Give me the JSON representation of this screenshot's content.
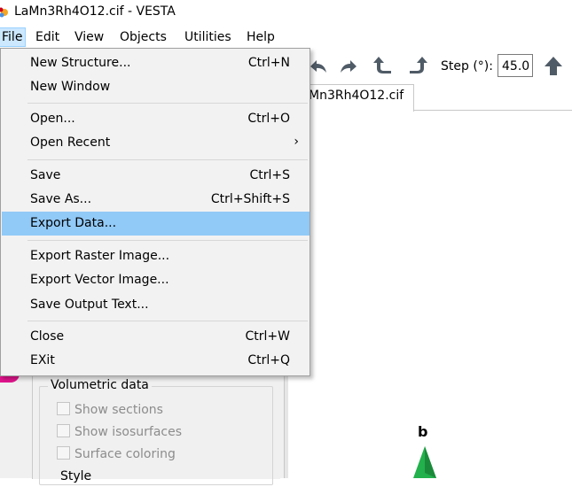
{
  "window": {
    "title": "LaMn3Rh4O12.cif - VESTA"
  },
  "menubar": {
    "items": [
      "File",
      "Edit",
      "View",
      "Objects",
      "Utilities",
      "Help"
    ]
  },
  "file_menu": {
    "items": [
      {
        "label": "New Structure...",
        "shortcut": "Ctrl+N"
      },
      {
        "label": "New Window",
        "shortcut": ""
      },
      {
        "label": "Open...",
        "shortcut": "Ctrl+O"
      },
      {
        "label": "Open Recent",
        "shortcut": "›"
      },
      {
        "label": "Save",
        "shortcut": "Ctrl+S"
      },
      {
        "label": "Save As...",
        "shortcut": "Ctrl+Shift+S"
      },
      {
        "label": "Export Data...",
        "shortcut": "",
        "highlighted": true
      },
      {
        "label": "Export Raster Image...",
        "shortcut": ""
      },
      {
        "label": "Export Vector Image...",
        "shortcut": ""
      },
      {
        "label": "Save Output Text...",
        "shortcut": ""
      },
      {
        "label": "Close",
        "shortcut": "Ctrl+W"
      },
      {
        "label": "EXit",
        "shortcut": "Ctrl+Q"
      }
    ]
  },
  "toolbar": {
    "step_label": "Step (°):",
    "step_value": "45.0"
  },
  "tab": {
    "label": "Mn3Rh4O12.cif"
  },
  "volumetric": {
    "title": "Volumetric data",
    "options": [
      "Show sections",
      "Show isosurfaces",
      "Surface coloring"
    ],
    "partial_label": "Style"
  },
  "viewport": {
    "axis_label": "b",
    "axis_color": "#22b14c"
  },
  "colors": {
    "highlight": "#91c9f7",
    "menu_bg": "#f2f2f2",
    "active_menu": "#cce8ff"
  }
}
